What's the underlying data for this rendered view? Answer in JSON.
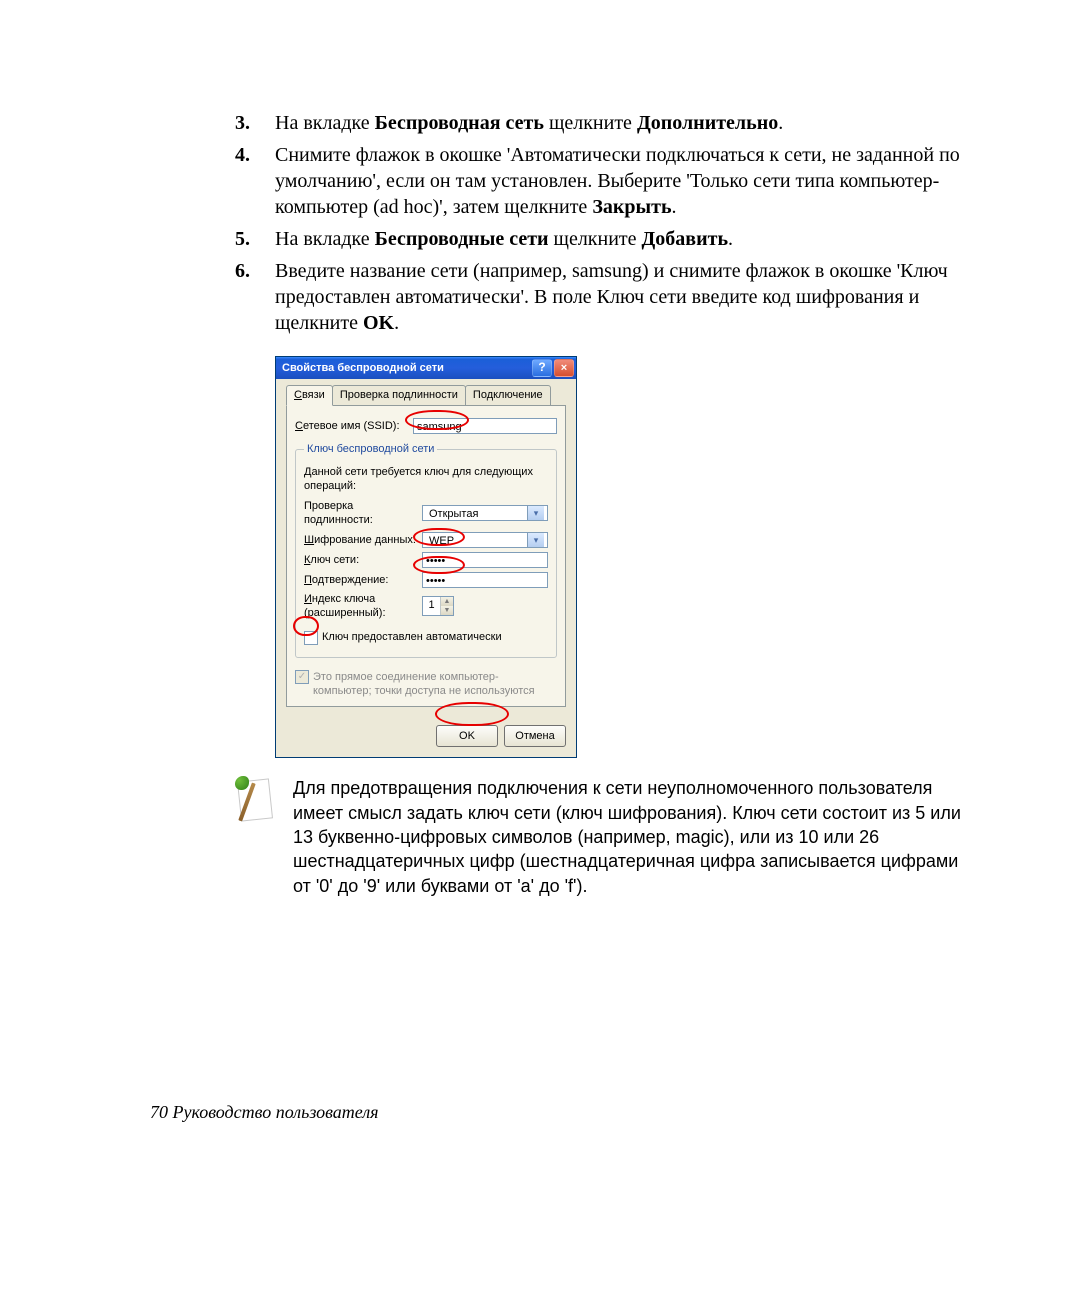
{
  "steps": {
    "n3": "3.",
    "t3_a": "На вкладке ",
    "t3_b": "Беспроводная сеть",
    "t3_c": " щелкните ",
    "t3_d": "Дополнительно",
    "t3_e": ".",
    "n4": "4.",
    "t4_a": "Снимите флажок в окошке 'Автоматически подключаться к сети, не заданной по умолчанию', если он там установлен. Выберите 'Только сети типа компьютер-компьютер (ad hoc)', затем щелкните ",
    "t4_b": "Закрыть",
    "t4_c": ".",
    "n5": "5.",
    "t5_a": "На вкладке ",
    "t5_b": "Беспроводные сети",
    "t5_c": " щелкните ",
    "t5_d": "Добавить",
    "t5_e": ".",
    "n6": "6.",
    "t6_a": "Введите название сети (например, samsung) и снимите флажок в окошке 'Ключ предоставлен автоматически'. В поле Ключ сети введите код шифрования и щелкните ",
    "t6_b": "OK",
    "t6_c": "."
  },
  "dlg": {
    "title": "Свойства беспроводной сети",
    "help": "?",
    "close": "×",
    "tabs": {
      "t1_u": "С",
      "t1_r": "вязи",
      "t2": "Проверка подлинности",
      "t3": "Подключение"
    },
    "ssid_lbl_u": "С",
    "ssid_lbl_r": "етевое имя (SSID):",
    "ssid_val": "samsung",
    "fs_legend": "Ключ беспроводной сети",
    "fs_hint": "Данной сети требуется ключ для следующих операций:",
    "auth_lbl": "Проверка подлинности:",
    "auth_val": "Открытая",
    "enc_u": "Ш",
    "enc_r": "ифрование данных:",
    "enc_val": "WEP",
    "key_u": "К",
    "key_r": "люч сети:",
    "key_val": "•••••",
    "conf_u": "П",
    "conf_r": "одтверждение:",
    "conf_val": "•••••",
    "idx_u": "И",
    "idx_r1": "ндекс ключа",
    "idx_r2": "(расширенный):",
    "idx_val": "1",
    "auto_u": "лю",
    "auto_pre": "К",
    "auto_r": "ч предоставлен автоматически",
    "adhoc_u": "Э",
    "adhoc_r": "то прямое соединение компьютер-компьютер; точки доступа не используются",
    "ok": "OK",
    "cancel": "Отмена"
  },
  "note": {
    "text": "Для предотвращения подключения к сети неуполномоченного пользователя имеет смысл задать ключ сети (ключ шифрования). Ключ сети состоит из 5 или 13 буквенно-цифровых символов (например, magic), или из 10 или 26 шестнадцатеричных цифр (шестнадцатеричная цифра записывается цифрами от '0' до '9' или буквами от 'a' до 'f')."
  },
  "footer": "70  Руководство пользователя"
}
